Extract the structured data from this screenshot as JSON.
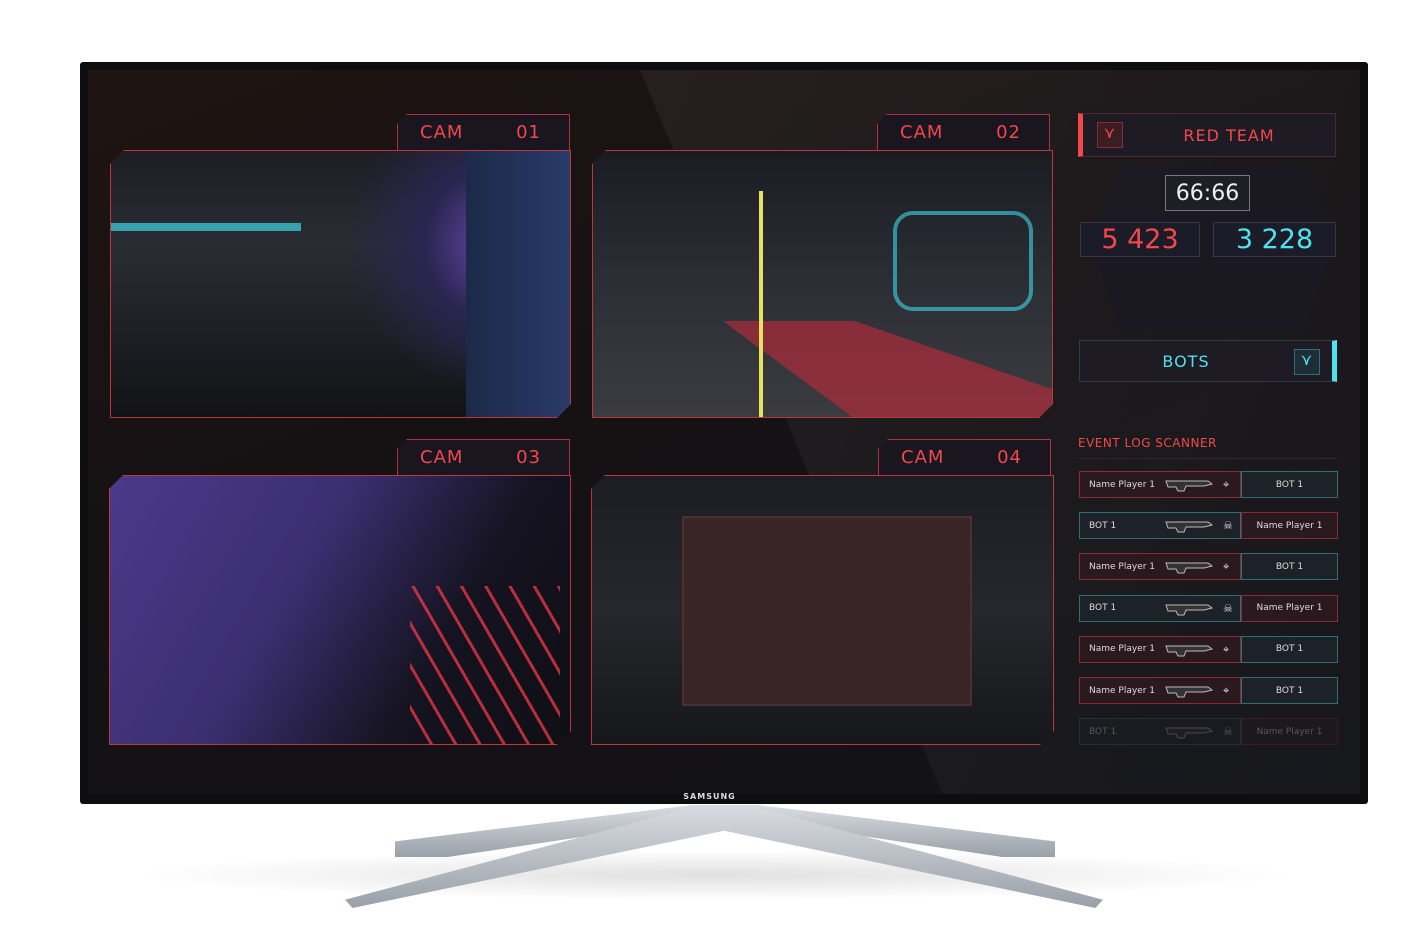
{
  "brand": "SAMSUNG",
  "cams": [
    {
      "label": "CAM",
      "num": "01"
    },
    {
      "label": "CAM",
      "num": "02"
    },
    {
      "label": "CAM",
      "num": "03"
    },
    {
      "label": "CAM",
      "num": "04"
    }
  ],
  "scoreboard": {
    "team_red": "RED TEAM",
    "team_blue": "BOTS",
    "timer": "66:66",
    "score_red": "5 423",
    "score_blue": "3 228"
  },
  "colors": {
    "red": "#f2484c",
    "cyan": "#4fe2ee"
  },
  "event_log": {
    "title": "EVENT LOG SCANNER",
    "rows": [
      {
        "left": "Name Player 1",
        "right": "BOT 1",
        "icon": "crosshair-icon",
        "side": "red"
      },
      {
        "left": "BOT 1",
        "right": "Name Player 1",
        "icon": "skull-icon",
        "side": "blue"
      },
      {
        "left": "Name Player 1",
        "right": "BOT 1",
        "icon": "crosshair-icon",
        "side": "red"
      },
      {
        "left": "BOT 1",
        "right": "Name Player 1",
        "icon": "skull-icon",
        "side": "blue"
      },
      {
        "left": "Name Player 1",
        "right": "BOT 1",
        "icon": "crosshair-icon",
        "side": "red"
      },
      {
        "left": "Name Player 1",
        "right": "BOT 1",
        "icon": "crosshair-icon",
        "side": "red"
      },
      {
        "left": "BOT 1",
        "right": "Name Player 1",
        "icon": "skull-icon",
        "side": "blue"
      }
    ]
  }
}
